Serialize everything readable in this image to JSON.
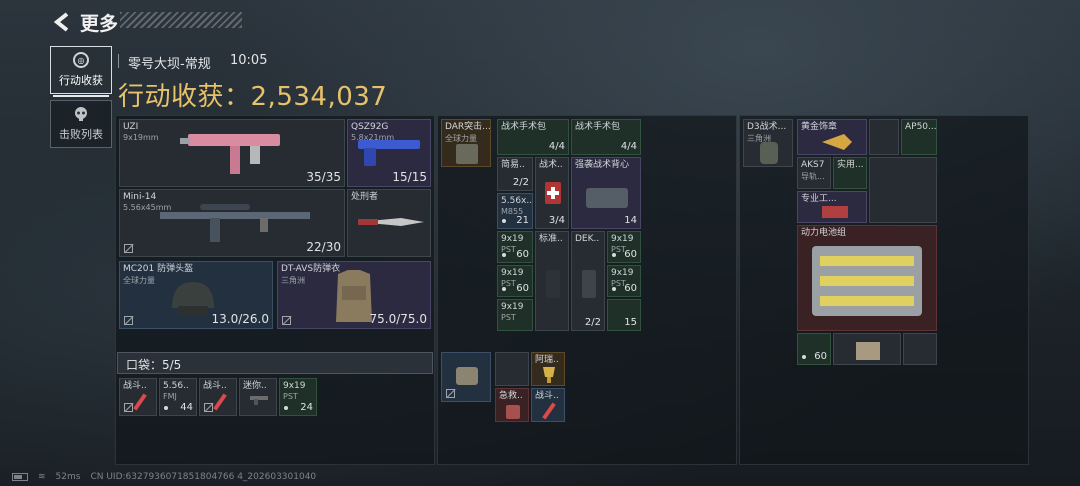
{
  "header": {
    "title": "更多"
  },
  "tabs": [
    {
      "label": "行动收获"
    },
    {
      "label": "击败列表"
    }
  ],
  "info": {
    "map": "零号大坝-常规",
    "time": "10:05",
    "earnings_label": "行动收获：",
    "earnings": "2,534,037"
  },
  "pocket": {
    "label": "口袋：5/5"
  },
  "equip": [
    {
      "name": "UZI",
      "sub": "9x19mm",
      "count": "35/35"
    },
    {
      "name": "QSZ92G",
      "sub": "5.8x21mm",
      "count": "15/15"
    },
    {
      "name": "Mini-14",
      "sub": "5.56x45mm",
      "count": "22/30"
    },
    {
      "name": "处刑者",
      "sub": "",
      "count": ""
    },
    {
      "name": "MC201 防弹头盔",
      "sub": "全球力量",
      "count": "13.0/26.0"
    },
    {
      "name": "DT-AVS防弹衣",
      "sub": "三角洲",
      "count": "75.0/75.0"
    }
  ],
  "pocket_items": [
    {
      "name": "战斗..",
      "count": ""
    },
    {
      "name": "5.56..",
      "sub": "FMJ",
      "count": "44"
    },
    {
      "name": "战斗..",
      "count": ""
    },
    {
      "name": "迷你..",
      "count": ""
    },
    {
      "name": "9x19",
      "sub": "PST",
      "count": "24"
    }
  ],
  "rig": [
    {
      "name": "DAR突击...",
      "sub": "全球力量"
    },
    {
      "name": "战术手术包",
      "count": "4/4"
    },
    {
      "name": "战术手术包",
      "count": "4/4"
    },
    {
      "name": "简易..",
      "count": "2/2"
    },
    {
      "name": "战术..",
      "count": "3/4"
    },
    {
      "name": "强袭战术背心",
      "sub": "阿萨拉",
      "count": "14"
    },
    {
      "name": "5.56x..",
      "sub": "M855",
      "count": "21"
    },
    {
      "name": "9x19",
      "sub": "PST",
      "count": "60"
    },
    {
      "name": "标准..",
      "count": ""
    },
    {
      "name": "DEK..",
      "count": ""
    },
    {
      "name": "9x19",
      "sub": "PST",
      "count": "60"
    },
    {
      "name": "9x19",
      "sub": "PST",
      "count": "60"
    },
    {
      "name": "9x19",
      "sub": "PST",
      "count": "60"
    },
    {
      "name": "9x19",
      "sub": "PST",
      "count": "60"
    },
    {
      "name": "",
      "count": "15"
    },
    {
      "name": "",
      "count": "2/2"
    }
  ],
  "misc": [
    {
      "name": "阿瑞..",
      "count": ""
    },
    {
      "name": "急救..",
      "count": ""
    },
    {
      "name": "战斗..",
      "count": ""
    }
  ],
  "backpack": [
    {
      "name": "D3战术...",
      "sub": "三角洲"
    },
    {
      "name": "黄金饰章"
    },
    {
      "name": "AP50..."
    },
    {
      "name": "AKS7",
      "sub": "导轨..."
    },
    {
      "name": "实用..."
    },
    {
      "name": "专业工..."
    },
    {
      "name": "动力电池组"
    },
    {
      "name": "9x19",
      "sub": "PST",
      "count": "60"
    }
  ],
  "status": {
    "ping": "52ms",
    "uid": "CN UID:6327936071851804766 4_202603301040"
  }
}
